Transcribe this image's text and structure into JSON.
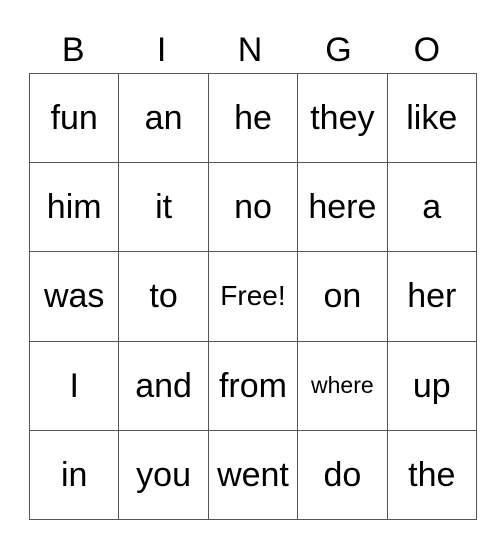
{
  "header": [
    "B",
    "I",
    "N",
    "G",
    "O"
  ],
  "rows": [
    [
      "fun",
      "an",
      "he",
      "they",
      "like"
    ],
    [
      "him",
      "it",
      "no",
      "here",
      "a"
    ],
    [
      "was",
      "to",
      "Free!",
      "on",
      "her"
    ],
    [
      "I",
      "and",
      "from",
      "where",
      "up"
    ],
    [
      "in",
      "you",
      "went",
      "do",
      "the"
    ]
  ]
}
